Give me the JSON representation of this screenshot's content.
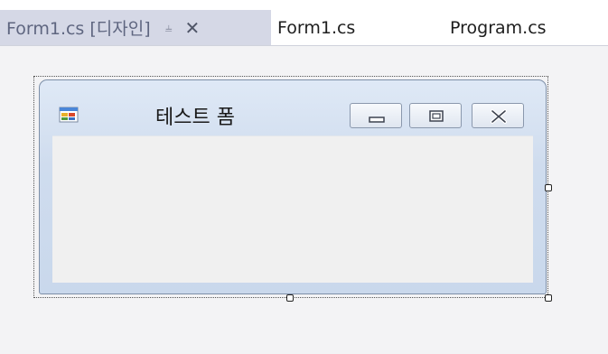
{
  "tabs": [
    {
      "label": "Form1.cs [디자인]",
      "pin_icon": "pin-icon",
      "close_icon": "close-icon",
      "active": true
    },
    {
      "label": "Form1.cs",
      "active": false
    },
    {
      "label": "Program.cs",
      "active": false
    }
  ],
  "form": {
    "title": "테스트 폼",
    "app_icon": "windows-form-icon",
    "buttons": {
      "minimize_icon": "minimize-icon",
      "maximize_icon": "maximize-icon",
      "close_icon": "close-icon"
    }
  },
  "colors": {
    "active_tab": "#d5d8e6",
    "form_frame": "#cfdcee",
    "client_area": "#f0f0f0",
    "surface": "#f3f3f5"
  }
}
